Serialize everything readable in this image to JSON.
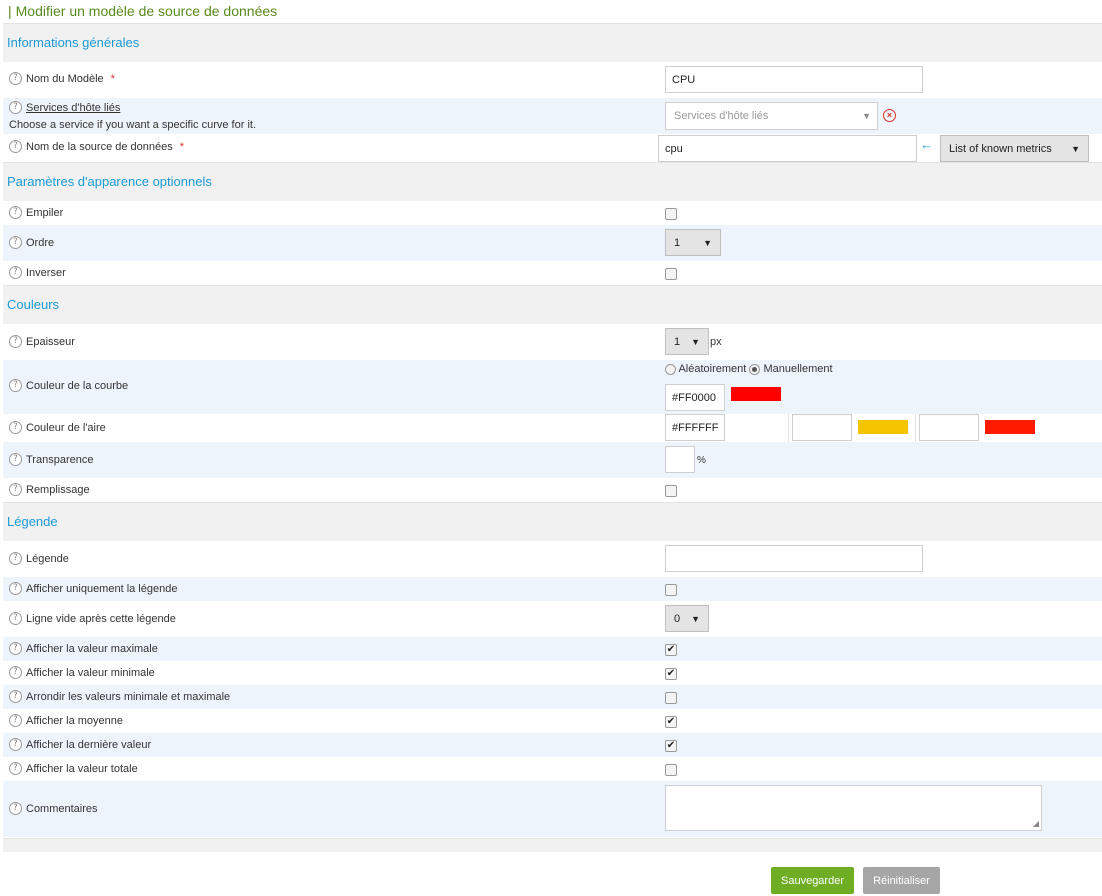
{
  "page": {
    "title": "Modifier un modèle de source de données",
    "title_bar": "|"
  },
  "help_glyph": "?",
  "required_mark": "*",
  "sections": {
    "general": "Informations générales",
    "appearance": "Paramètres d'apparence optionnels",
    "colors": "Couleurs",
    "legend": "Légende"
  },
  "general": {
    "model_name_label": "Nom du Modèle",
    "model_name_value": "CPU",
    "linked_services_label": "Services d'hôte liés",
    "linked_services_hint": "Choose a service if you want a specific curve for it.",
    "linked_services_placeholder": "Services d'hôte liés",
    "ds_name_label": "Nom de la source de données",
    "ds_name_value": "cpu",
    "known_metrics": "List of known metrics"
  },
  "appearance": {
    "stack_label": "Empiler",
    "order_label": "Ordre",
    "order_value": "1",
    "invert_label": "Inverser"
  },
  "colors": {
    "thickness_label": "Epaisseur",
    "thickness_value": "1",
    "thickness_unit": "px",
    "curve_color_label": "Couleur de la courbe",
    "random_label": "Aléatoirement",
    "manual_label": "Manuellement",
    "curve_color_value": "#FF0000",
    "curve_color_swatch": "#ff0000",
    "area_color_label": "Couleur de l'aire",
    "area_color_value": "#FFFFFF",
    "area_color_swatch": "#ffffff",
    "warning_color_value": "",
    "warning_color_swatch": "#f5c400",
    "critical_color_value": "",
    "critical_color_swatch": "#ff1a00",
    "transparency_label": "Transparence",
    "transparency_value": "",
    "transparency_unit": "%",
    "fill_label": "Remplissage"
  },
  "legend": {
    "legend_label": "Légende",
    "legend_value": "",
    "only_legend_label": "Afficher uniquement la légende",
    "empty_line_label": "Ligne vide après cette légende",
    "empty_line_value": "0",
    "show_max_label": "Afficher la valeur maximale",
    "show_min_label": "Afficher la valeur minimale",
    "round_label": "Arrondir les valeurs minimale et maximale",
    "show_avg_label": "Afficher la moyenne",
    "show_last_label": "Afficher la dernière valeur",
    "show_total_label": "Afficher la valeur totale",
    "comments_label": "Commentaires"
  },
  "checkbox_states": {
    "stack": false,
    "invert": false,
    "fill": false,
    "only_legend": false,
    "show_max": true,
    "show_min": true,
    "round": false,
    "show_avg": true,
    "show_last": true,
    "show_total": false
  },
  "buttons": {
    "save": "Sauvegarder",
    "reset": "Réinitialiser"
  },
  "colors_ui": {
    "accent": "#1a9ad6",
    "title": "#5a8a1c",
    "save": "#6fad24",
    "reset": "#a6a6a6",
    "required": "#d9302c"
  }
}
